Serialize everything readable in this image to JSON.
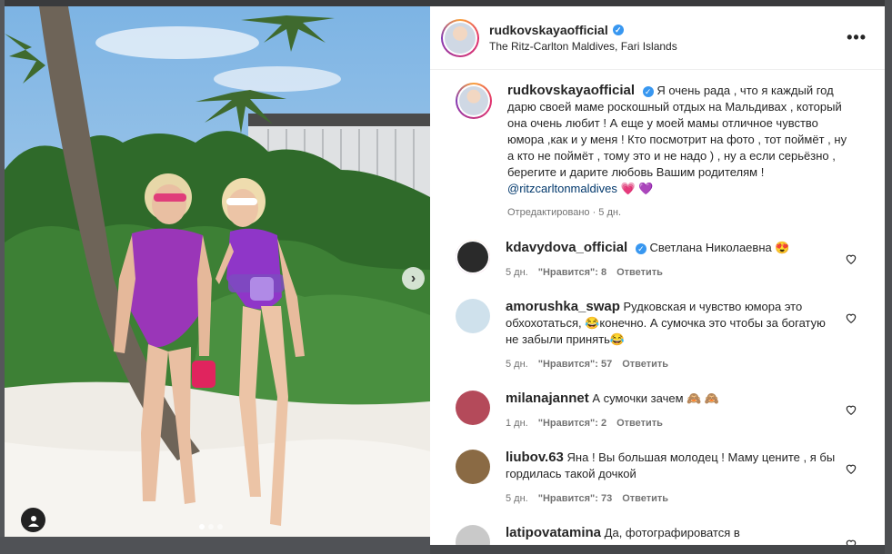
{
  "post": {
    "username": "rudkovskayaofficial",
    "location": "The Ritz-Carlton Maldives, Fari Islands",
    "more_label": "•••",
    "caption": {
      "username": "rudkovskayaofficial",
      "text": "Я очень рада , что я каждый год дарю своей маме роскошный отдых на Мальдивах , который она очень любит ! А еще у моей мамы отличное чувство юмора ,как и у меня ! Кто посмотрит на фото , тот поймёт , ну а кто не поймёт , тому это и не надо ) , ну а если серьёзно , берегите и дарите любовь Вашим родителям ! ",
      "mention": "@ritzcarltonmaldives",
      "emoji": "💗 💜",
      "meta": "Отредактировано · 5 дн."
    }
  },
  "comments": [
    {
      "username": "kdavydova_official",
      "verified": true,
      "text": "Светлана Николаевна 😍",
      "age": "5 дн.",
      "likes": "\"Нравится\": 8",
      "reply": "Ответить",
      "avatar_color": "#2a2a2a",
      "ring": true
    },
    {
      "username": "amorushka_swap",
      "verified": false,
      "text": "Рудковская и чувство юмора это обхохотаться, 😂конечно. А сумочка это чтобы за богатую не забыли принять😂",
      "age": "5 дн.",
      "likes": "\"Нравится\": 57",
      "reply": "Ответить",
      "avatar_color": "#cfe1ec",
      "ring": false
    },
    {
      "username": "milanajannet",
      "verified": false,
      "text": "А сумочки зачем 🙈 🙈",
      "age": "1 дн.",
      "likes": "\"Нравится\": 2",
      "reply": "Ответить",
      "avatar_color": "#b44a5a",
      "ring": false
    },
    {
      "username": "liubov.63",
      "verified": false,
      "text": "Яна ! Вы большая молодец ! Маму цените , я бы гордилась такой дочкой",
      "age": "5 дн.",
      "likes": "\"Нравится\": 73",
      "reply": "Ответить",
      "avatar_color": "#8a6a44",
      "ring": false
    },
    {
      "username": "latipovatamina",
      "verified": false,
      "text": "Да, фотографироватся в",
      "age": "",
      "likes": "",
      "reply": "",
      "avatar_color": "#c9c9c9",
      "ring": false
    }
  ],
  "carousel": {
    "next_glyph": "›",
    "dots_total": 3,
    "active_dot": 0
  },
  "colors": {
    "verified": "#3897f0",
    "accent_purple": "#9b3cc3"
  }
}
